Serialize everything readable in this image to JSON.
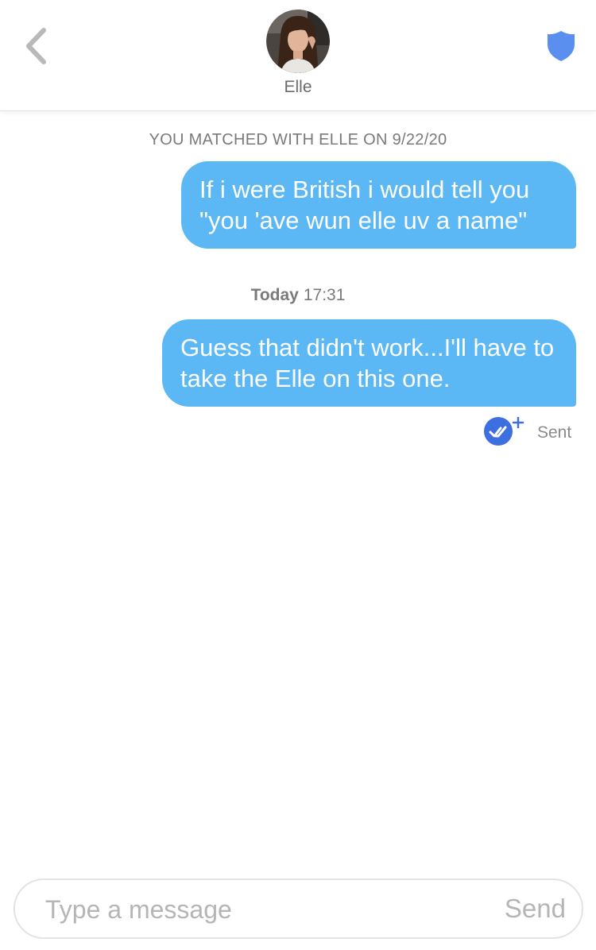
{
  "header": {
    "contact_name": "Elle",
    "back_icon": "chevron-left-icon",
    "safety_icon": "shield-icon",
    "accent_color": "#5a8ff0"
  },
  "chat": {
    "match_banner": "YOU MATCHED WITH ELLE ON 9/22/20",
    "messages": [
      {
        "text": "If i were British i would tell you \"you 'ave wun elle uv a name\"",
        "direction": "outgoing"
      },
      {
        "text": "Guess that didn't work...I'll have to take the Elle on this one.",
        "direction": "outgoing"
      }
    ],
    "timestamp": {
      "day": "Today",
      "time": "17:31"
    },
    "status": "Sent",
    "read_receipt_icon": "double-check-icon",
    "bubble_color": "#5bb8f5"
  },
  "composer": {
    "placeholder": "Type a message",
    "value": "",
    "send_label": "Send"
  }
}
